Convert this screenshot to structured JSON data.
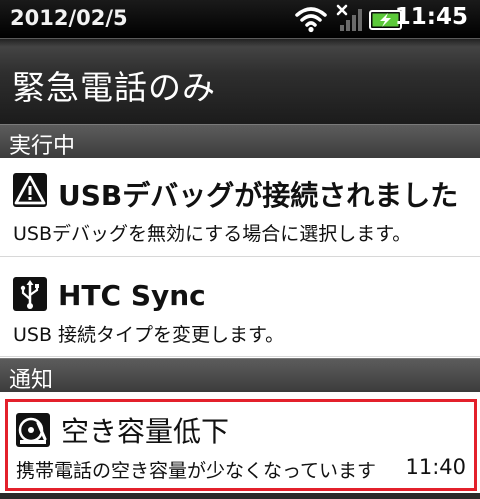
{
  "status_bar": {
    "date": "2012/02/5",
    "time": "11:45",
    "icons": [
      "wifi-icon",
      "no-signal-icon",
      "battery-charging-icon"
    ],
    "battery_color": "#5cc93a"
  },
  "title": "緊急電話のみ",
  "sections": {
    "running": "実行中",
    "notifications": "通知"
  },
  "running_items": [
    {
      "icon": "warning-icon",
      "title": "USBデバッグが接続されました",
      "subtitle": "USBデバッグを無効にする場合に選択します。"
    },
    {
      "icon": "usb-icon",
      "title": "HTC Sync",
      "subtitle": "USB 接続タイプを変更します。"
    }
  ],
  "notification_item": {
    "icon": "storage-icon",
    "title": "空き容量低下",
    "subtitle": "携帯電話の空き容量が少なくなっています",
    "time": "11:40",
    "highlight_color": "#e3202b"
  }
}
